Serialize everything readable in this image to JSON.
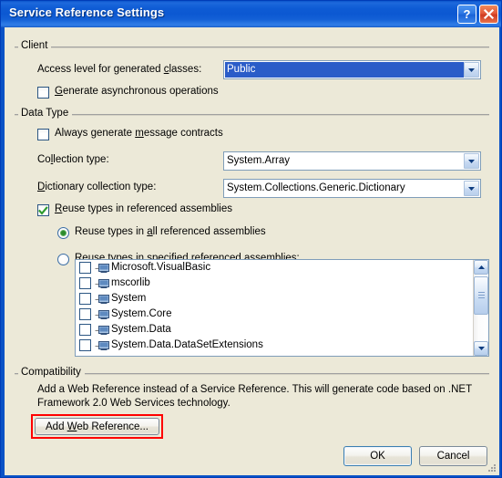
{
  "window": {
    "title": "Service Reference Settings",
    "help_button": "?",
    "close_button": "X",
    "background": "#ECE9D8",
    "titlebar_color": "#0C58D2"
  },
  "groups": {
    "client": {
      "title": "Client",
      "access_level_label_pre": "Access level for generated ",
      "access_level_label_accel": "c",
      "access_level_label_post": "lasses:",
      "access_level_value": "Public",
      "async_checkbox": {
        "pre": "",
        "accel": "G",
        "post": "enerate asynchronous operations",
        "checked": false
      }
    },
    "data_type": {
      "title": "Data Type",
      "message_contracts_checkbox": {
        "pre": "Always generate ",
        "accel": "m",
        "post": "essage contracts",
        "checked": false
      },
      "collection_type_label_pre": "Co",
      "collection_type_label_accel": "l",
      "collection_type_label_post": "lection type:",
      "collection_type_value": "System.Array",
      "dictionary_type_label_pre": "",
      "dictionary_type_label_accel": "D",
      "dictionary_type_label_post": "ictionary collection type:",
      "dictionary_type_value": "System.Collections.Generic.Dictionary",
      "reuse_checkbox": {
        "pre": "",
        "accel": "R",
        "post": "euse types in referenced assemblies",
        "checked": true
      },
      "reuse_all_radio": {
        "pre": "Reuse types in ",
        "accel": "a",
        "post": "ll referenced assemblies",
        "selected": true
      },
      "reuse_specified_radio": {
        "pre": "Reuse types in ",
        "accel": "s",
        "post": "pecified referenced assemblies:",
        "selected": false
      },
      "assembly_list": [
        {
          "label": "Microsoft.VisualBasic",
          "checked": false
        },
        {
          "label": "mscorlib",
          "checked": false
        },
        {
          "label": "System",
          "checked": false
        },
        {
          "label": "System.Core",
          "checked": false
        },
        {
          "label": "System.Data",
          "checked": false
        },
        {
          "label": "System.Data.DataSetExtensions",
          "checked": false
        }
      ]
    },
    "compatibility": {
      "title": "Compatibility",
      "description_line1": "Add a Web Reference instead of a Service Reference. This will generate code based on .NET",
      "description_line2": "Framework 2.0 Web Services technology.",
      "add_web_reference_button": {
        "pre": "Add ",
        "accel": "W",
        "post": "eb Reference...",
        "highlight_color": "#FF0000"
      }
    }
  },
  "footer": {
    "ok_label": "OK",
    "cancel_label": "Cancel"
  }
}
